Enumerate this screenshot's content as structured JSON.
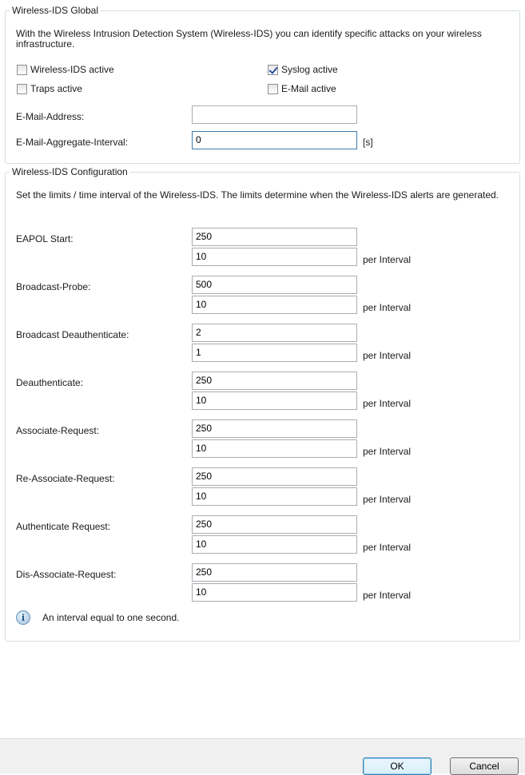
{
  "global": {
    "title": "Wireless-IDS Global",
    "description": "With the Wireless Intrusion Detection System (Wireless-IDS) you can identify specific attacks on your wireless infrastructure.",
    "checkboxes": {
      "wids_active": {
        "label": "Wireless-IDS active",
        "checked": false
      },
      "syslog_active": {
        "label": "Syslog active",
        "checked": true
      },
      "traps_active": {
        "label": "Traps active",
        "checked": false
      },
      "email_active": {
        "label": "E-Mail active",
        "checked": false
      }
    },
    "email_address": {
      "label": "E-Mail-Address:",
      "value": ""
    },
    "email_interval": {
      "label": "E-Mail-Aggregate-Interval:",
      "value": "0",
      "unit": "[s]"
    }
  },
  "config": {
    "title": "Wireless-IDS Configuration",
    "description": "Set the limits / time interval of the Wireless-IDS. The limits determine when the Wireless-IDS alerts are generated.",
    "per_interval_label": "per Interval",
    "items": [
      {
        "label": "EAPOL Start:",
        "limit": "250",
        "interval": "10"
      },
      {
        "label": "Broadcast-Probe:",
        "limit": "500",
        "interval": "10"
      },
      {
        "label": "Broadcast Deauthenticate:",
        "limit": "2",
        "interval": "1"
      },
      {
        "label": "Deauthenticate:",
        "limit": "250",
        "interval": "10"
      },
      {
        "label": "Associate-Request:",
        "limit": "250",
        "interval": "10"
      },
      {
        "label": "Re-Associate-Request:",
        "limit": "250",
        "interval": "10"
      },
      {
        "label": "Authenticate Request:",
        "limit": "250",
        "interval": "10"
      },
      {
        "label": "Dis-Associate-Request:",
        "limit": "250",
        "interval": "10"
      }
    ],
    "info_text": "An interval equal to one second."
  },
  "footer": {
    "ok_label": "OK",
    "cancel_label": "Cancel"
  }
}
